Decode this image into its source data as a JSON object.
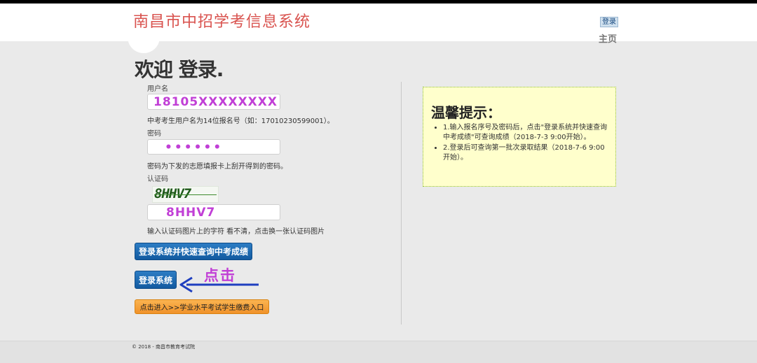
{
  "header": {
    "site_title": "南昌市中招学考信息系统",
    "login_link": "登录",
    "home_link": "主页"
  },
  "main": {
    "welcome": "欢迎 登录.",
    "username": {
      "label": "用户名",
      "value": "18105XXXXXXXX",
      "hint": "中考考生用户名为14位报名号（如：17010230599001）。"
    },
    "password": {
      "label": "密码",
      "value": "••••••",
      "hint": "密码为下发的志愿填报卡上刮开得到的密码。"
    },
    "captcha": {
      "label": "认证码",
      "image_text": "8HHV7",
      "value": "8HHV7",
      "hint": "输入认证码图片上的字符 看不清，点击换一张认证码图片"
    },
    "buttons": {
      "quick_query": "登录系统并快速查询中考成绩",
      "login": "登录系统",
      "payment": "点击进入>>学业水平考试学生缴费入口"
    },
    "annotation_text": "点击"
  },
  "tips": {
    "title": "温馨提示：",
    "items": [
      "1.输入报名序号及密码后，点击\"登录系统并快速查询中考成绩\"可查询成绩（2018-7-3 9:00开始）。",
      "2.登录后可查询第一批次录取结果（2018-7-6 9:00开始）。"
    ]
  },
  "footer": {
    "copyright": "© 2018 - 南昌市教育考试院"
  },
  "colors": {
    "title_red": "#d9534f",
    "annotation_purple": "#c13fd6",
    "arrow_blue": "#1f3fbf",
    "tips_bg": "#ffffcc"
  }
}
